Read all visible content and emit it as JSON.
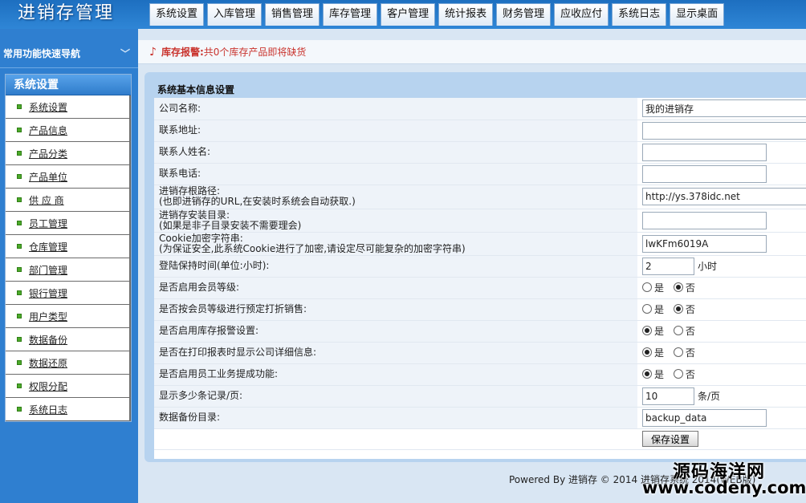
{
  "app": {
    "title": "进销存管理"
  },
  "nav": {
    "tabs": [
      "系统设置",
      "入库管理",
      "销售管理",
      "库存管理",
      "客户管理",
      "统计报表",
      "财务管理",
      "应收应付",
      "系统日志",
      "显示桌面"
    ]
  },
  "sidebar": {
    "title": "常用功能快速导航",
    "section": "系统设置",
    "items": [
      "系统设置",
      "产品信息",
      "产品分类",
      "产品单位",
      "供 应 商",
      "员工管理",
      "仓库管理",
      "部门管理",
      "银行管理",
      "用户类型",
      "数据备份",
      "数据还原",
      "权限分配",
      "系统日志"
    ]
  },
  "alert": {
    "label": "库存报警:",
    "text": "共0个库存产品即将缺货"
  },
  "settings": {
    "title": "系统基本信息设置",
    "company": {
      "label": "公司名称:",
      "value": "我的进销存"
    },
    "address": {
      "label": "联系地址:",
      "value": ""
    },
    "contact": {
      "label": "联系人姓名:",
      "value": ""
    },
    "phone": {
      "label": "联系电话:",
      "value": ""
    },
    "root_path": {
      "label1": "进销存根路径:",
      "label2": "(也即进销存的URL,在安装时系统会自动获取.)",
      "value": "http://ys.378idc.net"
    },
    "install_dir": {
      "label1": "进销存安装目录:",
      "label2": "(如果是非子目录安装不需要理会)",
      "value": ""
    },
    "cookie": {
      "label1": "Cookie加密字符串:",
      "label2": "(为保证安全,此系统Cookie进行了加密,请设定尽可能复杂的加密字符串)",
      "value": "lwKFm6019A"
    },
    "login_keep": {
      "label": "登陆保持时间(单位:小时):",
      "value": "2",
      "unit": "小时"
    },
    "member_level": {
      "label": "是否启用会员等级:",
      "selected": "no"
    },
    "member_discount": {
      "label": "是否按会员等级进行预定打折销售:",
      "selected": "no"
    },
    "stock_alarm": {
      "label": "是否启用库存报警设置:",
      "selected": "yes"
    },
    "print_company": {
      "label": "是否在打印报表时显示公司详细信息:",
      "selected": "yes"
    },
    "commission": {
      "label": "是否启用员工业务提成功能:",
      "selected": "yes"
    },
    "page_size": {
      "label": "显示多少条记录/页:",
      "value": "10",
      "unit": "条/页"
    },
    "backup_dir": {
      "label": "数据备份目录:",
      "value": "backup_data"
    },
    "yes_label": "是",
    "no_label": "否",
    "save_label": "保存设置"
  },
  "footer": {
    "text": "Powered By 进销存 © 2014 进销存系统 2014(WEB版)"
  },
  "watermark": {
    "line1": "源码海洋网",
    "line2": "www.codeny.com"
  }
}
